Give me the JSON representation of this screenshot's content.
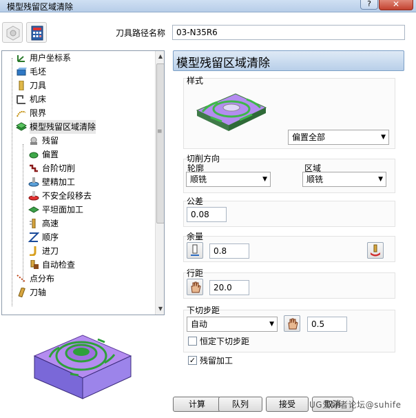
{
  "window": {
    "title": "模型残留区域清除",
    "help_label": "?",
    "close_label": "✕"
  },
  "toolpath": {
    "name_label": "刀具路径名称",
    "name_value": "03-N35R6"
  },
  "tree": {
    "items": [
      {
        "label": "用户坐标系",
        "icon": "ucs-icon"
      },
      {
        "label": "毛坯",
        "icon": "block-icon"
      },
      {
        "label": "刀具",
        "icon": "tool-icon"
      },
      {
        "label": "机床",
        "icon": "machine-icon"
      },
      {
        "label": "限界",
        "icon": "boundary-icon"
      },
      {
        "label": "模型残留区域清除",
        "icon": "rest-area-icon"
      },
      {
        "label": "残留",
        "icon": "rest-icon"
      },
      {
        "label": "偏置",
        "icon": "offset-icon"
      },
      {
        "label": "台阶切削",
        "icon": "step-cut-icon"
      },
      {
        "label": "壁精加工",
        "icon": "wall-finish-icon"
      },
      {
        "label": "不安全段移去",
        "icon": "unsafe-remove-icon"
      },
      {
        "label": "平坦面加工",
        "icon": "flat-face-icon"
      },
      {
        "label": "高速",
        "icon": "high-speed-icon"
      },
      {
        "label": "顺序",
        "icon": "order-icon"
      },
      {
        "label": "进刀",
        "icon": "lead-in-icon"
      },
      {
        "label": "自动检查",
        "icon": "auto-check-icon"
      },
      {
        "label": "点分布",
        "icon": "point-dist-icon"
      },
      {
        "label": "刀轴",
        "icon": "tool-axis-icon"
      }
    ]
  },
  "panel": {
    "title": "模型残留区域清除",
    "style": {
      "label": "样式",
      "value": "偏置全部"
    },
    "cut_direction": {
      "label": "切削方向",
      "profile_label": "轮廓",
      "profile_value": "顺铣",
      "area_label": "区域",
      "area_value": "顺铣"
    },
    "tolerance": {
      "label": "公差",
      "value": "0.08"
    },
    "allowance": {
      "label": "余量",
      "value": "0.8"
    },
    "stepover": {
      "label": "行距",
      "value": "20.0"
    },
    "stepdown": {
      "label": "下切步距",
      "mode_value": "自动",
      "value": "0.5",
      "constant_label": "恒定下切步距",
      "constant_checked": false
    },
    "rest_machining": {
      "label": "残留加工",
      "checked": true
    }
  },
  "buttons": {
    "calculate": "计算",
    "queue": "队列",
    "accept": "接受",
    "cancel": "取消"
  },
  "watermark": "UG爱好者论坛@suhife"
}
